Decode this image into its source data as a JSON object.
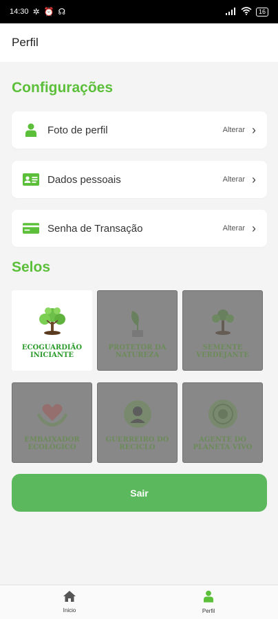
{
  "status_bar": {
    "time": "14:30",
    "battery": "16"
  },
  "header": {
    "title": "Perfil"
  },
  "settings": {
    "title": "Configurações",
    "items": [
      {
        "label": "Foto de perfil",
        "action": "Alterar",
        "icon": "user-icon"
      },
      {
        "label": "Dados pessoais",
        "action": "Alterar",
        "icon": "id-card-icon"
      },
      {
        "label": "Senha de Transação",
        "action": "Alterar",
        "icon": "credit-card-icon"
      }
    ]
  },
  "badges": {
    "title": "Selos",
    "items": [
      {
        "label": "ECOGUARDIÃO INICIANTE",
        "locked": false,
        "icon": "tree-icon"
      },
      {
        "label": "PROTETOR DA NATUREZA",
        "locked": true,
        "icon": "sprout-icon"
      },
      {
        "label": "SEMENTE VERDEJANTE",
        "locked": true,
        "icon": "tree-icon"
      },
      {
        "label": "EMBAIXADOR ECOLÓGICO",
        "locked": true,
        "icon": "heart-hands-icon"
      },
      {
        "label": "GUERREIRO DO RECICLO",
        "locked": true,
        "icon": "warrior-icon"
      },
      {
        "label": "AGENTE DO PLANETA VIVO",
        "locked": true,
        "icon": "seal-icon"
      }
    ]
  },
  "logout": {
    "label": "Sair"
  },
  "bottom_nav": {
    "items": [
      {
        "label": "Inicio",
        "icon": "home-icon",
        "active": false
      },
      {
        "label": "Perfil",
        "icon": "user-icon",
        "active": true
      }
    ]
  },
  "colors": {
    "accent": "#5cbf3a",
    "button": "#5cb85c",
    "locked_tile": "#888888"
  }
}
